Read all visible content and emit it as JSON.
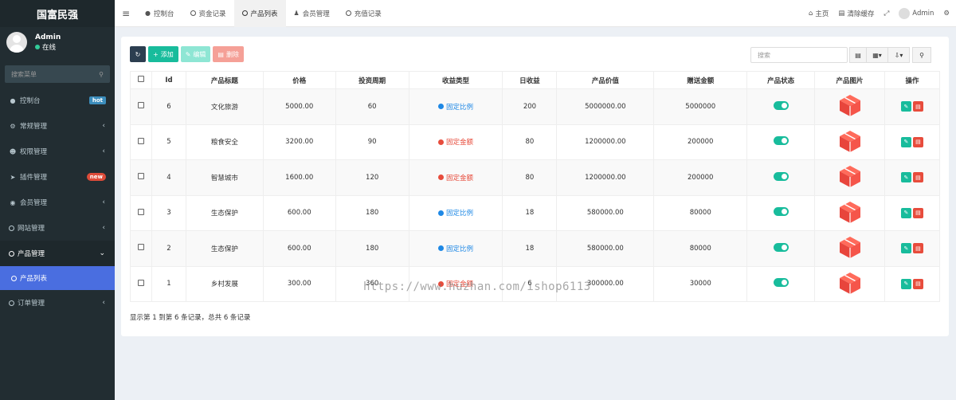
{
  "app": {
    "brand": "国富民强"
  },
  "user": {
    "name": "Admin",
    "status": "在线"
  },
  "sidebar": {
    "search_placeholder": "搜索菜单",
    "items": [
      {
        "label": "控制台",
        "icon": "dashboard-icon",
        "badge": "hot"
      },
      {
        "label": "常规管理",
        "icon": "cogs-icon"
      },
      {
        "label": "权限管理",
        "icon": "group-icon"
      },
      {
        "label": "插件管理",
        "icon": "rocket-icon",
        "badge": "new"
      },
      {
        "label": "会员管理",
        "icon": "user-circle-icon"
      },
      {
        "label": "网站管理",
        "icon": "circle-icon"
      },
      {
        "label": "产品管理",
        "icon": "circle-icon"
      },
      {
        "label": "产品列表",
        "icon": "circle-icon"
      },
      {
        "label": "订单管理",
        "icon": "circle-icon"
      }
    ]
  },
  "tabs": [
    {
      "label": "控制台",
      "icon": "dashboard-icon"
    },
    {
      "label": "资金记录",
      "icon": "circle-icon"
    },
    {
      "label": "产品列表",
      "icon": "circle-icon"
    },
    {
      "label": "会员管理",
      "icon": "user-icon"
    },
    {
      "label": "充值记录",
      "icon": "circle-icon"
    }
  ],
  "topright": {
    "home": "主页",
    "clear_cache": "清除缓存",
    "admin": "Admin"
  },
  "toolbar": {
    "add": "添加",
    "edit": "编辑",
    "delete": "删除",
    "search_placeholder": "搜索"
  },
  "table": {
    "headers": [
      "Id",
      "产品标题",
      "价格",
      "投资周期",
      "收益类型",
      "日收益",
      "产品价值",
      "赠送金额",
      "产品状态",
      "产品图片",
      "操作"
    ],
    "rows": [
      {
        "id": "6",
        "title": "文化旅游",
        "price": "5000.00",
        "period": "60",
        "type": "固定比例",
        "type_color": "#1e88e5",
        "daily": "200",
        "value": "5000000.00",
        "gift": "5000000"
      },
      {
        "id": "5",
        "title": "粮食安全",
        "price": "3200.00",
        "period": "90",
        "type": "固定金额",
        "type_color": "#e74c3c",
        "daily": "80",
        "value": "1200000.00",
        "gift": "200000"
      },
      {
        "id": "4",
        "title": "智慧城市",
        "price": "1600.00",
        "period": "120",
        "type": "固定金额",
        "type_color": "#e74c3c",
        "daily": "80",
        "value": "1200000.00",
        "gift": "200000"
      },
      {
        "id": "3",
        "title": "生态保护",
        "price": "600.00",
        "period": "180",
        "type": "固定比例",
        "type_color": "#1e88e5",
        "daily": "18",
        "value": "580000.00",
        "gift": "80000"
      },
      {
        "id": "2",
        "title": "生态保护",
        "price": "600.00",
        "period": "180",
        "type": "固定比例",
        "type_color": "#1e88e5",
        "daily": "18",
        "value": "580000.00",
        "gift": "80000"
      },
      {
        "id": "1",
        "title": "乡村发展",
        "price": "300.00",
        "period": "360",
        "type": "固定金额",
        "type_color": "#e74c3c",
        "daily": "6",
        "value": "300000.00",
        "gift": "30000"
      }
    ]
  },
  "pager": "显示第 1 到第 6 条记录，总共 6 条记录",
  "watermark": "https://www.huzhan.com/ishop6113"
}
